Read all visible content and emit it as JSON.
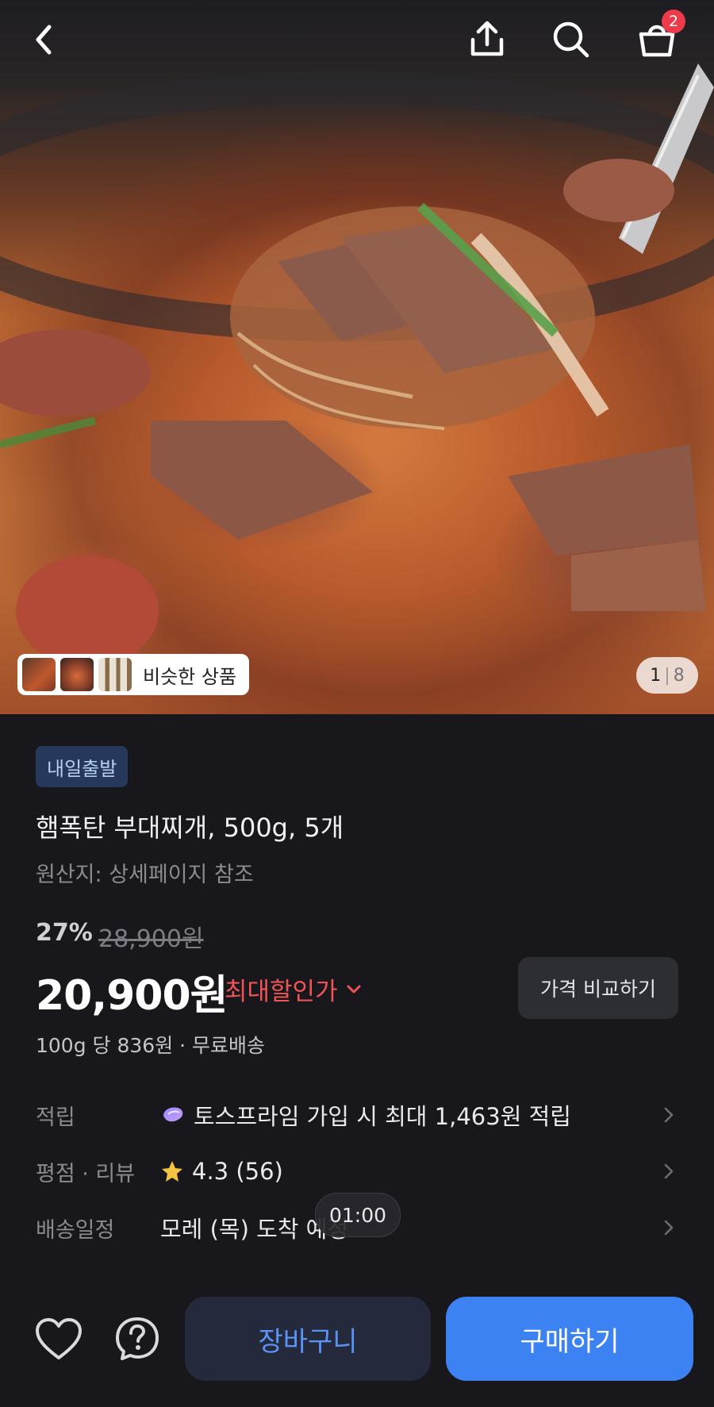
{
  "header": {
    "back_icon": "chevron-left-icon",
    "share_icon": "share-icon",
    "search_icon": "search-icon",
    "cart_icon": "shopping-bag-icon",
    "cart_badge": "2"
  },
  "gallery": {
    "similar_label": "비슷한 상품",
    "current": "1",
    "separator": "|",
    "total": "8"
  },
  "product": {
    "tag": "내일출발",
    "title": "햄폭탄 부대찌개, 500g, 5개",
    "origin": "원산지: 상세페이지 참조",
    "discount_pct": "27%",
    "original_price": "28,900원",
    "price": "20,900원",
    "max_discount_label": "최대할인가",
    "compare_label": "가격 비교하기",
    "unit_price": "100g 당 836원 · 무료배송"
  },
  "info": [
    {
      "label": "적립",
      "value": "토스프라임 가입 시 최대 1,463원 적립",
      "icon": "prime-gem-icon"
    },
    {
      "label": "평점 · 리뷰",
      "value": "4.3 (56)",
      "icon": "star-icon"
    },
    {
      "label": "배송일정",
      "value": "모레 (목) 도착 예정",
      "icon": ""
    }
  ],
  "timer": "01:00",
  "bottom": {
    "wishlist_icon": "heart-icon",
    "help_icon": "question-icon",
    "cart_label": "장바구니",
    "buy_label": "구매하기"
  },
  "colors": {
    "background": "#17171c",
    "accent_blue": "#3d82f3",
    "discount_red": "#f05454",
    "tag_bg": "#26395c",
    "badge_red": "#ee3b4a"
  }
}
